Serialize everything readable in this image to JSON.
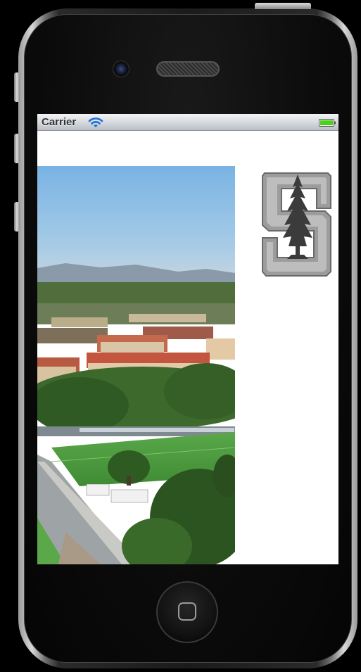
{
  "status_bar": {
    "carrier": "Carrier",
    "wifi_icon": "wifi-icon",
    "battery_icon": "battery-full-icon",
    "battery_color": "#4cd01c"
  },
  "content": {
    "photo_icon": "campus-aerial-photo",
    "logo_icon": "stanford-s-tree-logo",
    "background": "#ffffff"
  },
  "device": {
    "camera_icon": "front-camera-icon",
    "speaker_icon": "earpiece-speaker-icon",
    "home_icon": "home-button-icon"
  }
}
